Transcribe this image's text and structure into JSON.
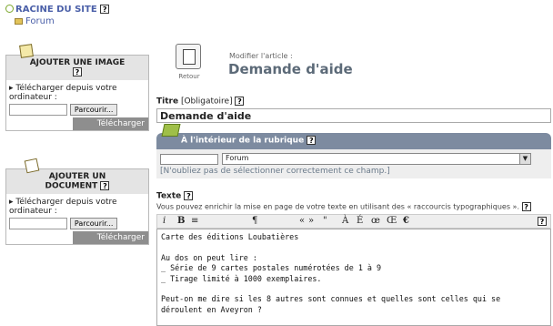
{
  "breadcrumb": {
    "root": "RACINE DU SITE",
    "forum": "Forum",
    "help": "?"
  },
  "add_image": {
    "title": "AJOUTER UNE IMAGE",
    "help": "?",
    "upload_text": "Télécharger depuis votre ordinateur :",
    "browse_label": "Parcourir...",
    "submit_label": "Télécharger"
  },
  "add_document": {
    "title_line1": "AJOUTER UN",
    "title_line2": "DOCUMENT",
    "help": "?",
    "upload_text": "Télécharger depuis votre ordinateur :",
    "browse_label": "Parcourir...",
    "submit_label": "Télécharger"
  },
  "header": {
    "back_label": "Retour",
    "modify_label": "Modifier l'article :",
    "article_title": "Demande d'aide"
  },
  "titre": {
    "label": "Titre",
    "required": "[Obligatoire]",
    "help": "?",
    "value": "Demande d'aide"
  },
  "rubrique": {
    "label": "À l'intérieur de la rubrique",
    "help": "?",
    "selected": "Forum",
    "note": "[N'oubliez pas de sélectionner correctement ce champ.]"
  },
  "texte": {
    "label": "Texte",
    "help": "?",
    "hint": "Vous pouvez enrichir la mise en page de votre texte en utilisant des « raccourcis typographiques ».",
    "toolbar": [
      "i",
      "B",
      "≡",
      "¶",
      "«",
      "»",
      "\"",
      "À",
      "É",
      "œ",
      "Œ",
      "€",
      "?"
    ],
    "content": "Carte des éditions Loubatières\n\nAu dos on peut lire :\n_ Série de 9 cartes postales numérotées de 1 à 9\n_ Tirage limité à 1000 exemplaires.\n\nPeut-on me dire si les 8 autres sont connues et quelles sont celles qui se\ndéroulent en Aveyron ?"
  }
}
